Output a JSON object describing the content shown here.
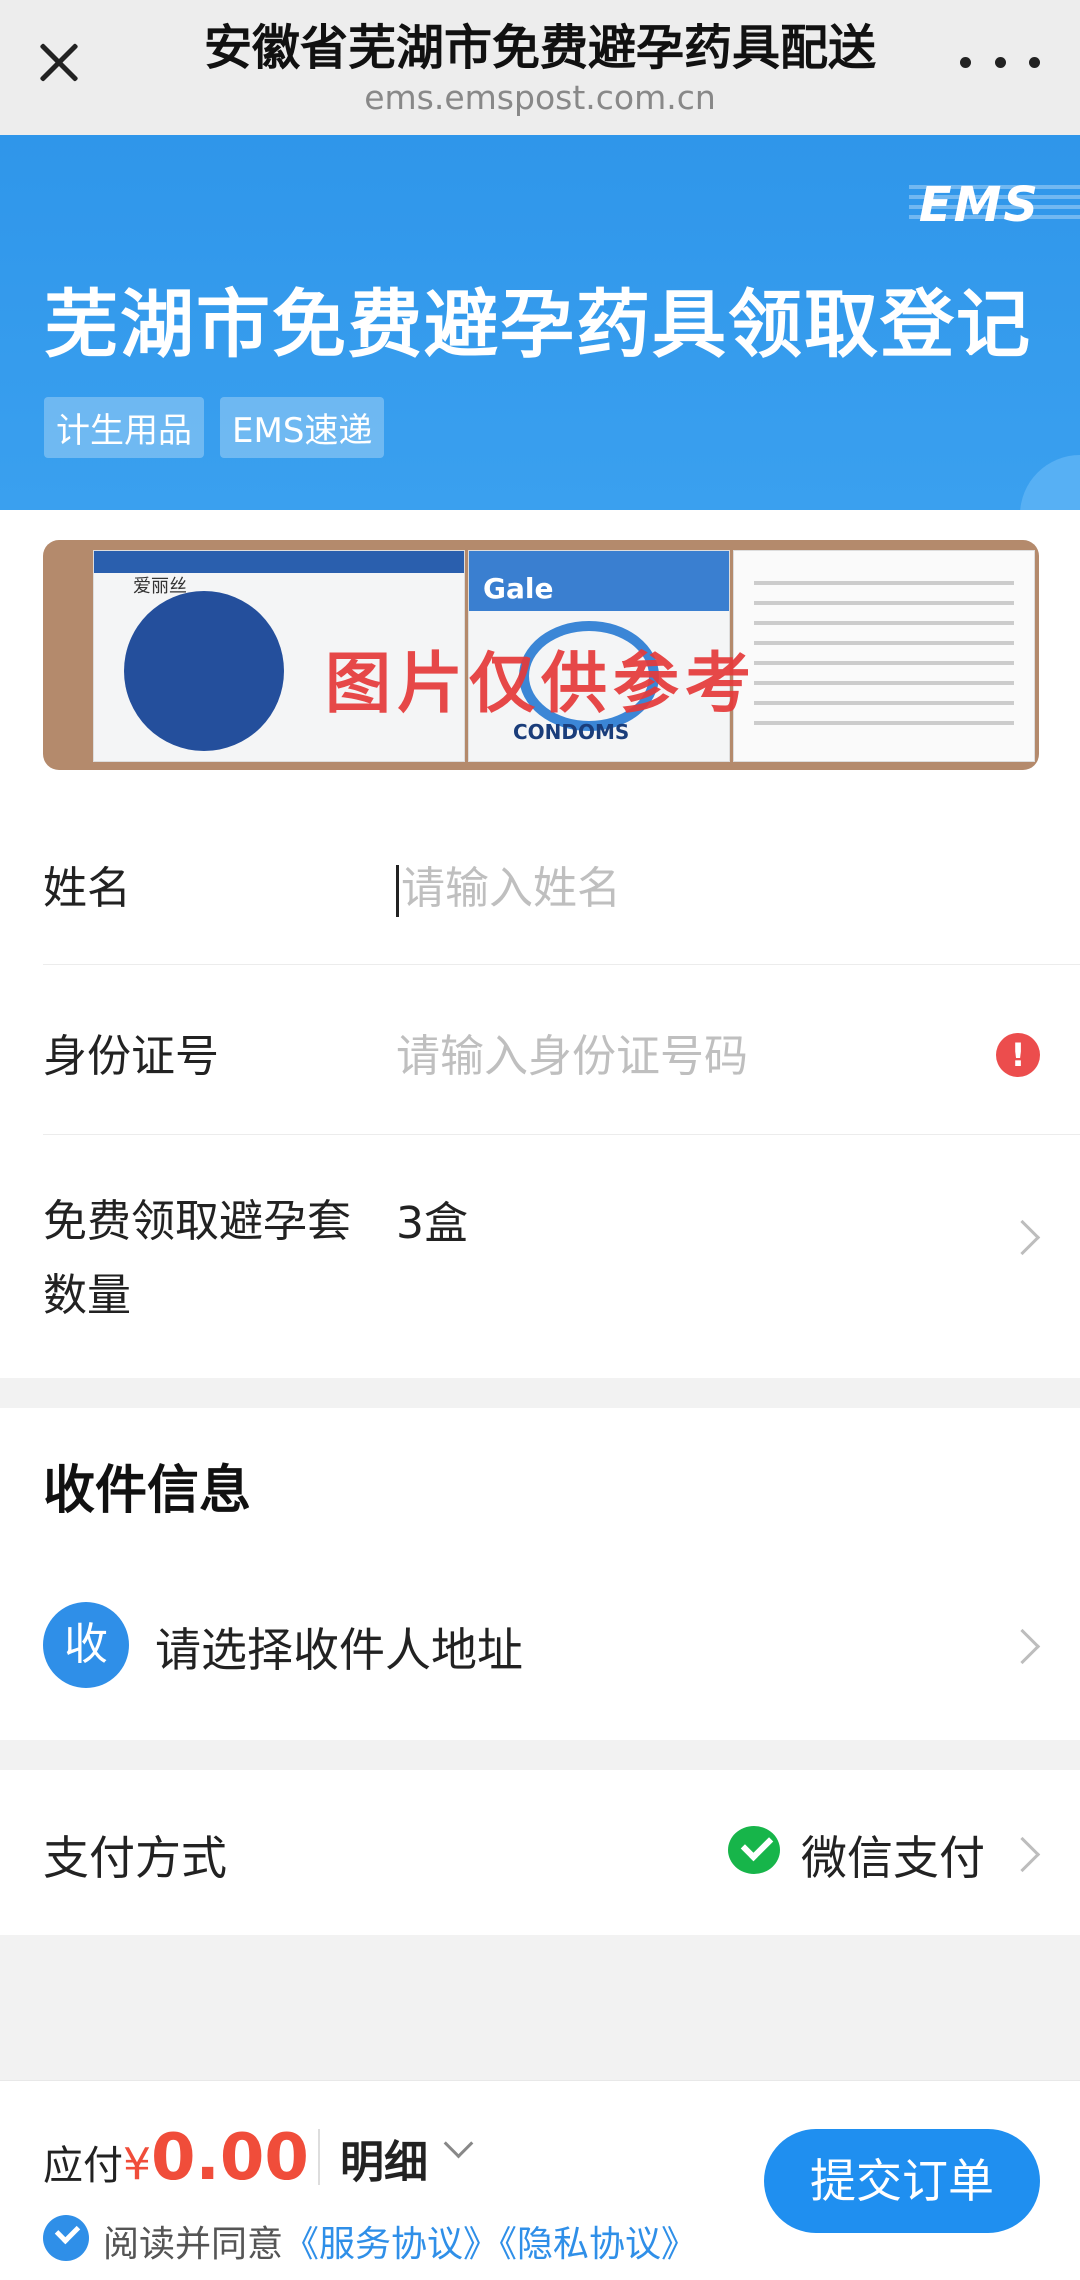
{
  "topbar": {
    "title": "安徽省芜湖市免费避孕药具配送",
    "url": "ems.emspost.com.cn"
  },
  "banner": {
    "logo": "EMS",
    "title": "芜湖市免费避孕药具领取登记",
    "tags": [
      "计生用品",
      "EMS速递"
    ]
  },
  "product_image": {
    "brand1": "爱丽丝",
    "brand2": "Gale",
    "product": "CONDOMS",
    "watermark": "图片仅供参考"
  },
  "form": {
    "name": {
      "label": "姓名",
      "placeholder": "请输入姓名"
    },
    "id_number": {
      "label": "身份证号",
      "placeholder": "请输入身份证号码",
      "error_icon": "!"
    },
    "quantity": {
      "label": "免费领取避孕套数量",
      "value": "3盒"
    }
  },
  "receiver": {
    "title": "收件信息",
    "badge": "收",
    "prompt": "请选择收件人地址"
  },
  "payment": {
    "label": "支付方式",
    "method": "微信支付"
  },
  "footer": {
    "due_label": "应付",
    "currency": "¥",
    "amount": "0.00",
    "detail": "明细",
    "agree_text": "阅读并同意",
    "service_link": "《服务协议》",
    "privacy_link": "《隐私协议》",
    "submit": "提交订单"
  },
  "colors": {
    "brand_blue": "#2f96ea",
    "price_red": "#f04d3a",
    "wechat_green": "#17b54a",
    "error_red": "#ec4d4d"
  }
}
